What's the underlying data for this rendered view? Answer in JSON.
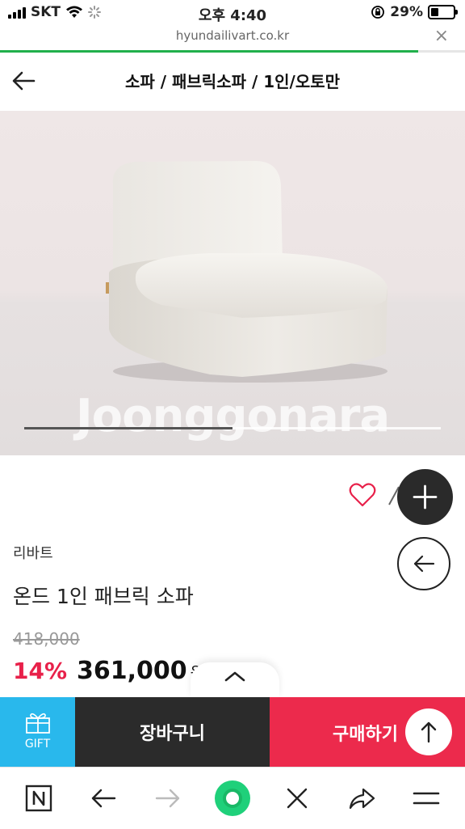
{
  "status_bar": {
    "carrier": "SKT",
    "time": "오후 4:40",
    "battery": "29%",
    "battery_level": 0.29
  },
  "url_bar": {
    "url": "hyundailivart.co.kr",
    "close_label": "×",
    "load_progress": 0.9
  },
  "header": {
    "breadcrumb": "소파 / 패브릭소파 / 1인/오토만"
  },
  "hero": {
    "watermark": "Joonggonara",
    "slide_position": 0.5
  },
  "product": {
    "brand": "리바트",
    "name": "온드 1인 패브릭 소파",
    "original_price": "418,000",
    "discount": "14%",
    "price": "361,000",
    "currency": "원"
  },
  "action_bar": {
    "gift": "GIFT",
    "cart": "장바구니",
    "buy": "구매하기"
  },
  "colors": {
    "accent_red": "#ec2a4c",
    "gift_blue": "#29b8ec",
    "dark": "#2b2b2b",
    "loading_green": "#21b04b"
  },
  "icons": {
    "bottom_nav": [
      "naver-n-icon",
      "back-arrow-icon",
      "forward-arrow-icon",
      "home-circle-icon",
      "close-icon",
      "share-icon",
      "menu-icon"
    ]
  }
}
